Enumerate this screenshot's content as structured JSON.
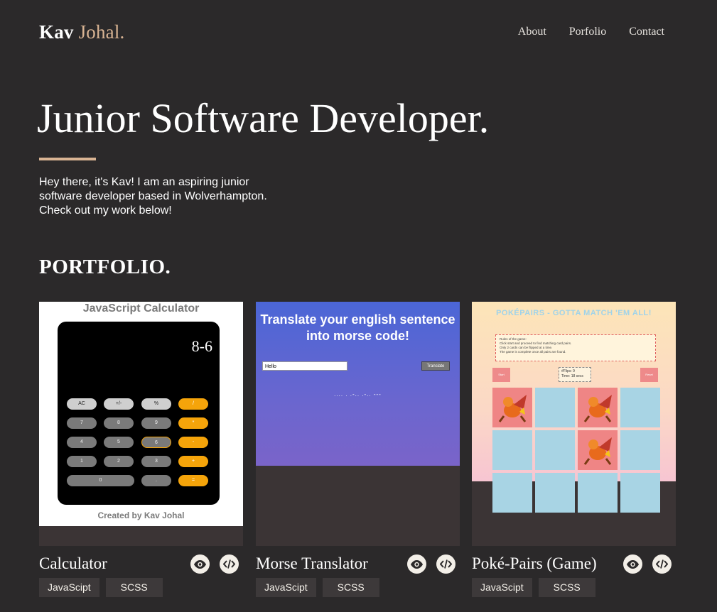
{
  "header": {
    "logo_first": "Kav",
    "logo_second": "Johal.",
    "nav": [
      "About",
      "Porfolio",
      "Contact"
    ]
  },
  "hero": {
    "title": "Junior Software Developer.",
    "text": "Hey there, it's Kav! I am an aspiring junior software developer based in Wolverhampton. Check out my work below!"
  },
  "portfolio": {
    "heading": "PORTFOLIO.",
    "cards": [
      {
        "title": "Calculator",
        "tags": [
          "JavaScipt",
          "SCSS"
        ],
        "preview": {
          "heading": "JavaScript Calculator",
          "display": "8-6",
          "keys": [
            "AC",
            "+/-",
            "%",
            "/",
            "7",
            "8",
            "9",
            "*",
            "4",
            "5",
            "6",
            "-",
            "1",
            "2",
            "3",
            "+",
            "0",
            ".",
            "="
          ],
          "footer": "Created by Kav Johal"
        }
      },
      {
        "title": "Morse Translator",
        "tags": [
          "JavaScipt",
          "SCSS"
        ],
        "preview": {
          "heading": "Translate your english sentence into morse code!",
          "input_value": "Hello",
          "button": "Translate",
          "output": ".... . .-.. .-.. ---"
        }
      },
      {
        "title": "Poké-Pairs (Game)",
        "tags": [
          "JavaScipt",
          "SCSS"
        ],
        "preview": {
          "heading": "POKÉPAIRS - GOTTA MATCH 'EM ALL!",
          "rules_title": "Rules of the game:",
          "rules": [
            "Click start and proceed to find matching card pairs.",
            "Only 2 cards can be flipped at a time.",
            "The game is complete once all pairs are found."
          ],
          "start": "Start",
          "reset": "Reset",
          "flips": "#Flips: 9",
          "time": "Time: 18 secs"
        }
      }
    ]
  },
  "colors": {
    "background": "#2b292a",
    "accent": "#d9b493",
    "tag_bg": "#3d393a"
  }
}
